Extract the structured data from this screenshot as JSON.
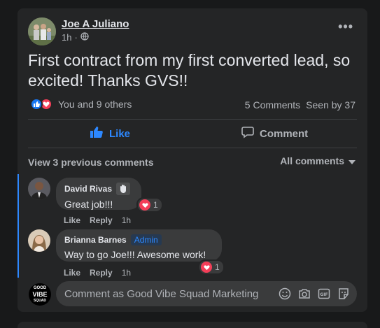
{
  "post": {
    "author": "Joe A Juliano",
    "time": "1h",
    "text": "First contract from my first converted lead, so excited! Thanks GVS!!",
    "reactions_text": "You and 9 others",
    "comments_count": "5 Comments",
    "seen_by": "Seen by 37"
  },
  "actions": {
    "like_label": "Like",
    "comment_label": "Comment"
  },
  "comments_section": {
    "view_previous": "View 3 previous comments",
    "filter_label": "All comments"
  },
  "comments": [
    {
      "name": "David Rivas",
      "text": "Great job!!!",
      "reaction_count": "1",
      "like": "Like",
      "reply": "Reply",
      "time": "1h"
    },
    {
      "name": "Brianna Barnes",
      "badge": "Admin",
      "text": "Way to go Joe!!! Awesome work!",
      "reaction_count": "1",
      "like": "Like",
      "reply": "Reply",
      "time": "1h"
    }
  ],
  "composer": {
    "placeholder": "Comment as Good Vibe Squad Marketing",
    "avatar_lines": [
      "GOOD",
      "VIBE",
      "SQUAD"
    ]
  },
  "colors": {
    "background": "#18191a",
    "card": "#242526",
    "accent_blue": "#2d88ff",
    "love_red": "#f33e58"
  }
}
